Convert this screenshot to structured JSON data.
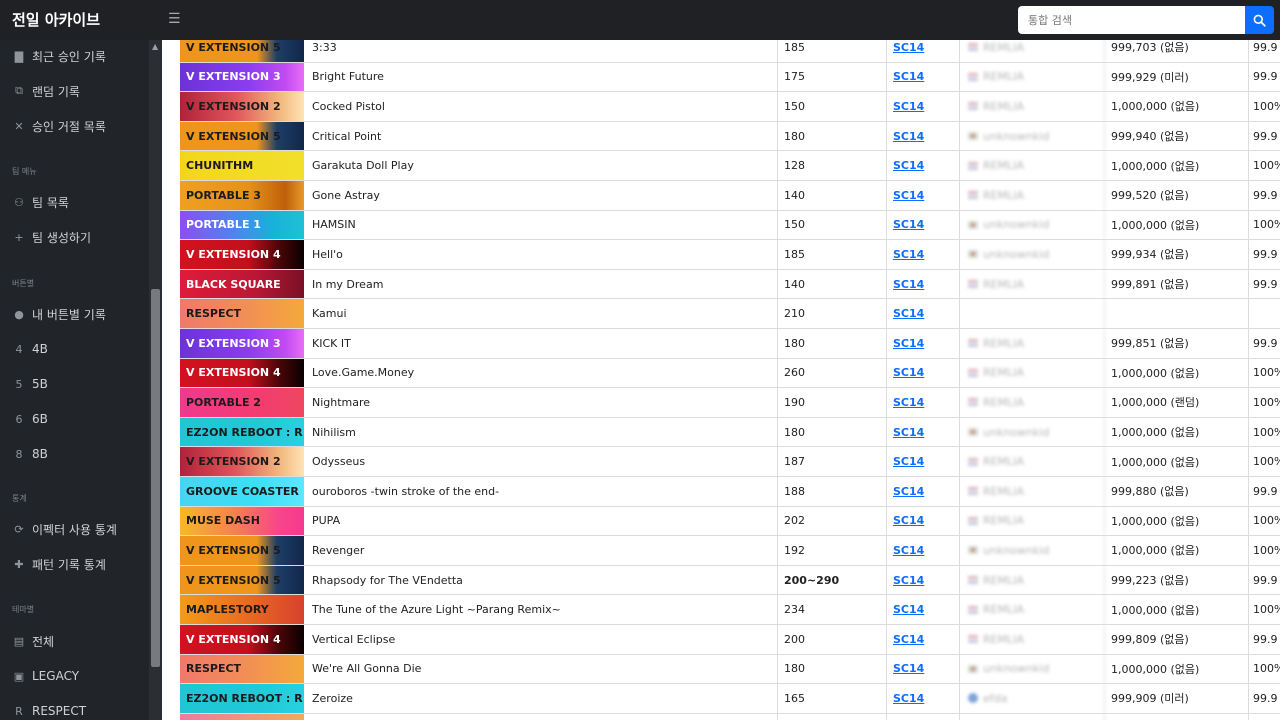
{
  "app": {
    "title": "전일 아카이브",
    "menu_icon": "hamburger-icon"
  },
  "search": {
    "placeholder": "통합 검색",
    "icon": "search-icon"
  },
  "sidebar": {
    "items": [
      {
        "label": "최근 승인 기록",
        "icon": "clipboard-icon"
      },
      {
        "label": "랜덤 기록",
        "icon": "dice-icon"
      },
      {
        "label": "승인 거절 목록",
        "icon": "close-icon"
      },
      {
        "label": "팀 목록",
        "icon": "people-icon"
      },
      {
        "label": "팀 생성하기",
        "icon": "plus-icon"
      },
      {
        "label": "내 버튼별 기록",
        "icon": "person-icon"
      },
      {
        "label": "4B",
        "icon": "4"
      },
      {
        "label": "5B",
        "icon": "5"
      },
      {
        "label": "6B",
        "icon": "6"
      },
      {
        "label": "8B",
        "icon": "8"
      },
      {
        "label": "이펙터 사용 통계",
        "icon": "refresh-icon"
      },
      {
        "label": "패턴 기록 통계",
        "icon": "puzzle-icon"
      },
      {
        "label": "전체",
        "icon": "box-icon"
      },
      {
        "label": "LEGACY",
        "icon": "train-icon"
      },
      {
        "label": "RESPECT",
        "icon": "R"
      }
    ],
    "sections": [
      "팀 메뉴",
      "버튼별",
      "통계",
      "테마별"
    ]
  },
  "table": {
    "rows": [
      {
        "dlc": "V EXTENSION 5",
        "title": "3:33",
        "level": "185",
        "pattern": "SC14",
        "user": "REMLIA",
        "flag": "us",
        "result": "999,703 (없음)",
        "pct": "99.9"
      },
      {
        "dlc": "V EXTENSION 3",
        "title": "Bright Future",
        "level": "175",
        "pattern": "SC14",
        "user": "REMLIA",
        "flag": "us",
        "result": "999,929 (미러)",
        "pct": "99.9"
      },
      {
        "dlc": "V EXTENSION 2",
        "title": "Cocked Pistol",
        "level": "150",
        "pattern": "SC14",
        "user": "REMLIA",
        "flag": "us",
        "result": "1,000,000 (없음)",
        "pct": "100%"
      },
      {
        "dlc": "V EXTENSION 5",
        "title": "Critical Point",
        "level": "180",
        "pattern": "SC14",
        "user": "unknownkid",
        "flag": "kr",
        "result": "999,940 (없음)",
        "pct": "99.9"
      },
      {
        "dlc": "CHUNITHM",
        "title": "Garakuta Doll Play",
        "level": "128",
        "pattern": "SC14",
        "user": "REMLIA",
        "flag": "us",
        "result": "1,000,000 (없음)",
        "pct": "100%"
      },
      {
        "dlc": "PORTABLE 3",
        "title": "Gone Astray",
        "level": "140",
        "pattern": "SC14",
        "user": "REMLIA",
        "flag": "us",
        "result": "999,520 (없음)",
        "pct": "99.9"
      },
      {
        "dlc": "PORTABLE 1",
        "title": "HAMSIN",
        "level": "150",
        "pattern": "SC14",
        "user": "unknownkid",
        "flag": "kr",
        "result": "1,000,000 (없음)",
        "pct": "100%"
      },
      {
        "dlc": "V EXTENSION 4",
        "title": "Hell'o",
        "level": "185",
        "pattern": "SC14",
        "user": "unknownkid",
        "flag": "kr",
        "result": "999,934 (없음)",
        "pct": "99.9"
      },
      {
        "dlc": "BLACK SQUARE",
        "title": "In my Dream",
        "level": "140",
        "pattern": "SC14",
        "user": "REMLIA",
        "flag": "us",
        "result": "999,891 (없음)",
        "pct": "99.9"
      },
      {
        "dlc": "RESPECT",
        "title": "Kamui",
        "level": "210",
        "pattern": "SC14",
        "user": "",
        "flag": "",
        "result": "",
        "pct": ""
      },
      {
        "dlc": "V EXTENSION 3",
        "title": "KICK IT",
        "level": "180",
        "pattern": "SC14",
        "user": "REMLIA",
        "flag": "us",
        "result": "999,851 (없음)",
        "pct": "99.9"
      },
      {
        "dlc": "V EXTENSION 4",
        "title": "Love.Game.Money",
        "level": "260",
        "pattern": "SC14",
        "user": "REMLIA",
        "flag": "us",
        "result": "1,000,000 (없음)",
        "pct": "100%"
      },
      {
        "dlc": "PORTABLE 2",
        "title": "Nightmare",
        "level": "190",
        "pattern": "SC14",
        "user": "REMLIA",
        "flag": "us",
        "result": "1,000,000 (랜덤)",
        "pct": "100%"
      },
      {
        "dlc": "EZ2ON REBOOT : R",
        "title": "Nihilism",
        "level": "180",
        "pattern": "SC14",
        "user": "unknownkid",
        "flag": "kr",
        "result": "1,000,000 (없음)",
        "pct": "100%"
      },
      {
        "dlc": "V EXTENSION 2",
        "title": "Odysseus",
        "level": "187",
        "pattern": "SC14",
        "user": "REMLIA",
        "flag": "us",
        "result": "1,000,000 (없음)",
        "pct": "100%"
      },
      {
        "dlc": "GROOVE COASTER",
        "title": "ouroboros -twin stroke of the end-",
        "level": "188",
        "pattern": "SC14",
        "user": "REMLIA",
        "flag": "us",
        "result": "999,880 (없음)",
        "pct": "99.9"
      },
      {
        "dlc": "MUSE DASH",
        "title": "PUPA",
        "level": "202",
        "pattern": "SC14",
        "user": "REMLIA",
        "flag": "us",
        "result": "1,000,000 (없음)",
        "pct": "100%"
      },
      {
        "dlc": "V EXTENSION 5",
        "title": "Revenger",
        "level": "192",
        "pattern": "SC14",
        "user": "unknownkid",
        "flag": "kr",
        "result": "1,000,000 (없음)",
        "pct": "100%"
      },
      {
        "dlc": "V EXTENSION 5",
        "title": "Rhapsody for The VEndetta",
        "level": "200~290",
        "level_bold": true,
        "pattern": "SC14",
        "user": "REMLIA",
        "flag": "us",
        "result": "999,223 (없음)",
        "pct": "99.9"
      },
      {
        "dlc": "MAPLESTORY",
        "title": "The Tune of the Azure Light ~Parang Remix~",
        "level": "234",
        "pattern": "SC14",
        "user": "REMLIA",
        "flag": "us",
        "result": "1,000,000 (없음)",
        "pct": "100%"
      },
      {
        "dlc": "V EXTENSION 4",
        "title": "Vertical Eclipse",
        "level": "200",
        "pattern": "SC14",
        "user": "REMLIA",
        "flag": "us",
        "result": "999,809 (없음)",
        "pct": "99.9"
      },
      {
        "dlc": "RESPECT",
        "title": "We're All Gonna Die",
        "level": "180",
        "pattern": "SC14",
        "user": "unknownkid",
        "flag": "kr",
        "result": "1,000,000 (없음)",
        "pct": "100%"
      },
      {
        "dlc": "EZ2ON REBOOT : R",
        "title": "Zeroize",
        "level": "165",
        "pattern": "SC14",
        "user": "efda",
        "flag": "avatar",
        "result": "999,909 (미러)",
        "pct": "99.9"
      },
      {
        "dlc": "",
        "title": "",
        "level": "",
        "pattern": "",
        "user": "",
        "flag": "",
        "result": "",
        "pct": ""
      }
    ]
  },
  "dlc_styles": {
    "V EXTENSION 5": {
      "bg": "linear-gradient(90deg,#f0951c 0%,#f0951c 62%,#1d3f66 78%,#12264a 100%)",
      "fg": "#1b1b1b"
    },
    "V EXTENSION 3": {
      "bg": "linear-gradient(90deg,#6b33d6 0%,#8a3df0 55%,#c24bf2 85%,#e86ef5 100%)",
      "fg": "#ffffff"
    },
    "V EXTENSION 2": {
      "bg": "linear-gradient(90deg,#b0223a 0%,#e0565a 45%,#f2b77c 80%,#ffe3b5 100%)",
      "fg": "#1b1b1b"
    },
    "CHUNITHM": {
      "bg": "linear-gradient(90deg,#f3d61c 0%,#f1e02a 100%)",
      "fg": "#1b1b1b"
    },
    "PORTABLE 3": {
      "bg": "linear-gradient(90deg,#f0a020 0%,#e6921a 55%,#c0600a 85%,#e69a2a 100%)",
      "fg": "#1b1b1b"
    },
    "PORTABLE 1": {
      "bg": "linear-gradient(90deg,#8d4df5 0%,#4b86f0 45%,#17b2d8 75%,#1ec2d6 100%)",
      "fg": "#ffffff"
    },
    "V EXTENSION 4": {
      "bg": "linear-gradient(90deg,#d3121f 0%,#c30f1c 55%,#4a0508 80%,#0a0000 100%)",
      "fg": "#ffffff"
    },
    "BLACK SQUARE": {
      "bg": "linear-gradient(90deg,#df1c3a 0%,#bb1735 60%,#7a1026 100%)",
      "fg": "#ffffff"
    },
    "RESPECT": {
      "bg": "linear-gradient(90deg,#f07a6a 0%,#f28a5a 45%,#f4a93a 100%)",
      "fg": "#1b1b1b"
    },
    "PORTABLE 2": {
      "bg": "linear-gradient(90deg,#f1398e 0%,#f23b74 55%,#f04660 100%)",
      "fg": "#1b1b1b"
    },
    "EZ2ON REBOOT : R": {
      "bg": "linear-gradient(90deg,#21c6d4 0%,#20c8d8 60%,#28d1e0 100%)",
      "fg": "#1b1b1b"
    },
    "GROOVE COASTER": {
      "bg": "linear-gradient(90deg,#47d4f2 0%,#39e0f5 60%,#5be7ff 100%)",
      "fg": "#1b1b1b"
    },
    "MUSE DASH": {
      "bg": "linear-gradient(90deg,#f7b926 0%,#f77f4f 45%,#f7458b 80%,#f43a8f 100%)",
      "fg": "#1b1b1b"
    },
    "MAPLESTORY": {
      "bg": "linear-gradient(90deg,#f39b1a 0%,#e86a22 55%,#d8412d 100%)",
      "fg": "#1b1b1b"
    },
    "": {
      "bg": "linear-gradient(90deg,#f07aa0 0%,#f4a95a 100%)",
      "fg": "#1b1b1b"
    }
  },
  "colors": {
    "sidebar_bg": "#212529",
    "link": "#0d6efd",
    "search_button": "#0d6efd"
  }
}
